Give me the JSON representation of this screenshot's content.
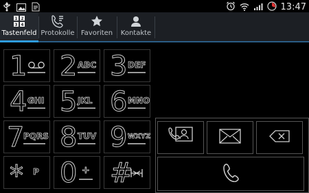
{
  "status": {
    "time": "13:47"
  },
  "tabs": [
    {
      "label": "Tastenfeld",
      "icon": "keypad-icon"
    },
    {
      "label": "Protokolle",
      "icon": "call-log-icon"
    },
    {
      "label": "Favoriten",
      "icon": "star-icon"
    },
    {
      "label": "Kontakte",
      "icon": "contact-icon"
    }
  ],
  "keypad": [
    {
      "digit": "1",
      "letters": "",
      "extra": "voicemail-icon"
    },
    {
      "digit": "2",
      "letters": "ABC"
    },
    {
      "digit": "3",
      "letters": "DEF"
    },
    {
      "digit": "4",
      "letters": "GHI"
    },
    {
      "digit": "5",
      "letters": "JKL"
    },
    {
      "digit": "6",
      "letters": "MNO"
    },
    {
      "digit": "7",
      "letters": "PQRS"
    },
    {
      "digit": "8",
      "letters": "TUV"
    },
    {
      "digit": "9",
      "letters": "WXYZ"
    },
    {
      "digit": "*",
      "letters": "P"
    },
    {
      "digit": "0",
      "letters": "+"
    },
    {
      "digit": "#",
      "letters": "",
      "extra": "mute-icon"
    }
  ],
  "colors": {
    "accent": "#2f9cde",
    "tabbar": "#1c1f24"
  }
}
